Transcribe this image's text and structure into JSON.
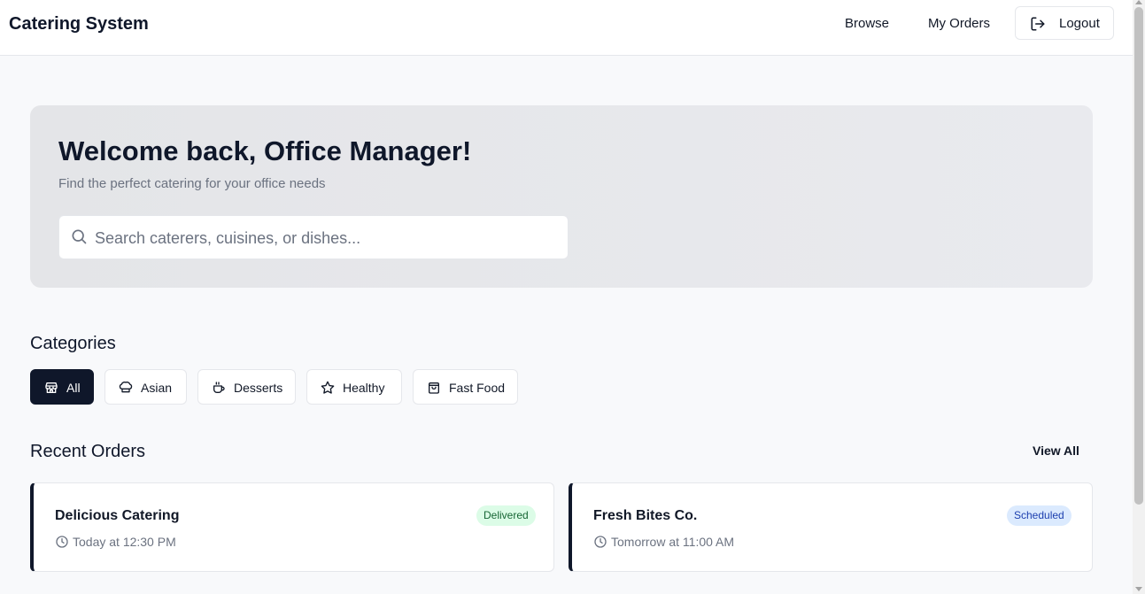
{
  "header": {
    "brand": "Catering System",
    "nav": {
      "browse": "Browse",
      "my_orders": "My Orders",
      "logout": "Logout"
    }
  },
  "hero": {
    "title": "Welcome back, Office Manager!",
    "subtitle": "Find the perfect catering for your office needs",
    "search_placeholder": "Search caterers, cuisines, or dishes..."
  },
  "categories": {
    "title": "Categories",
    "items": [
      {
        "label": "All",
        "icon": "store-icon",
        "active": true
      },
      {
        "label": "Asian",
        "icon": "chef-hat-icon",
        "active": false
      },
      {
        "label": "Desserts",
        "icon": "coffee-cup-icon",
        "active": false
      },
      {
        "label": "Healthy",
        "icon": "star-icon",
        "active": false
      },
      {
        "label": "Fast Food",
        "icon": "shopping-bag-icon",
        "active": false
      }
    ]
  },
  "recent_orders": {
    "title": "Recent Orders",
    "view_all": "View All",
    "items": [
      {
        "name": "Delicious Catering",
        "time": "Today at 12:30 PM",
        "status": "Delivered"
      },
      {
        "name": "Fresh Bites Co.",
        "time": "Tomorrow at 11:00 AM",
        "status": "Scheduled"
      }
    ]
  },
  "colors": {
    "primary": "#0f172a",
    "delivered_bg": "#dcfce7",
    "delivered_text": "#166534",
    "scheduled_bg": "#dbeafe",
    "scheduled_text": "#1e40af"
  }
}
